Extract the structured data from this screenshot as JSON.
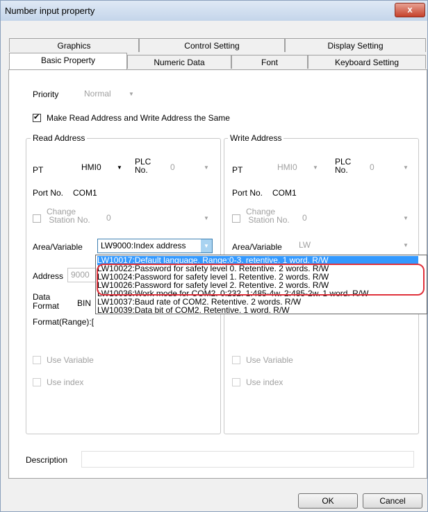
{
  "window": {
    "title": "Number input property",
    "close_label": "x"
  },
  "tabs_back": [
    "Graphics",
    "Control Setting",
    "Display Setting"
  ],
  "tabs_front": [
    "Basic Property",
    "Numeric Data",
    "Font",
    "Keyboard Setting"
  ],
  "priority": {
    "label": "Priority",
    "value": "Normal"
  },
  "same_address": {
    "label": "Make Read Address and Write Address the Same",
    "checked": true
  },
  "read": {
    "group_title": "Read Address",
    "pt_label": "PT",
    "pt_value": "HMI0",
    "plc_label_1": "PLC",
    "plc_label_2": "No.",
    "plc_value": "0",
    "port_label": "Port No.",
    "port_value": "COM1",
    "change_label_1": "Change",
    "change_label_2": "Station No.",
    "station_value": "0",
    "area_label": "Area/Variable",
    "area_value": "LW9000:Index address",
    "address_label": "Address",
    "address_value": "9000",
    "data_label_1": "Data",
    "data_label_2": "Format",
    "data_value": "BIN",
    "format_range_label": "Format(Range):[",
    "use_variable": "Use Variable",
    "use_index": "Use index"
  },
  "write": {
    "group_title": "Write Address",
    "pt_label": "PT",
    "pt_value": "HMI0",
    "plc_label_1": "PLC",
    "plc_label_2": "No.",
    "plc_value": "0",
    "port_label": "Port No.",
    "port_value": "COM1",
    "change_label_1": "Change",
    "change_label_2": "Station No.",
    "station_value": "0",
    "area_label": "Area/Variable",
    "area_value": "LW",
    "use_variable": "Use Variable",
    "use_index": "Use index"
  },
  "dropdown_options": [
    "LW10017:Default language. Range:0-3. retentive. 1 word. R/W",
    "LW10022:Password for safety level 0. Retentive. 2 words. R/W",
    "LW10024:Password for safety level 1. Retentive. 2 words. R/W",
    "LW10026:Password for safety level 2. Retentive. 2 words. R/W",
    "LW10036:Work mode for COM2. 0:232. 1:485-4w. 2:485-2w. 1 word. R/W",
    "LW10037:Baud rate of COM2. Retentive. 2 words. R/W",
    "LW10039:Data bit of COM2. Retentive. 1 word. R/W"
  ],
  "description_label": "Description",
  "buttons": {
    "ok": "OK",
    "cancel": "Cancel"
  },
  "colors": {
    "highlight": "#e0303a",
    "selection": "#3399ff",
    "close": "#c5412b"
  }
}
